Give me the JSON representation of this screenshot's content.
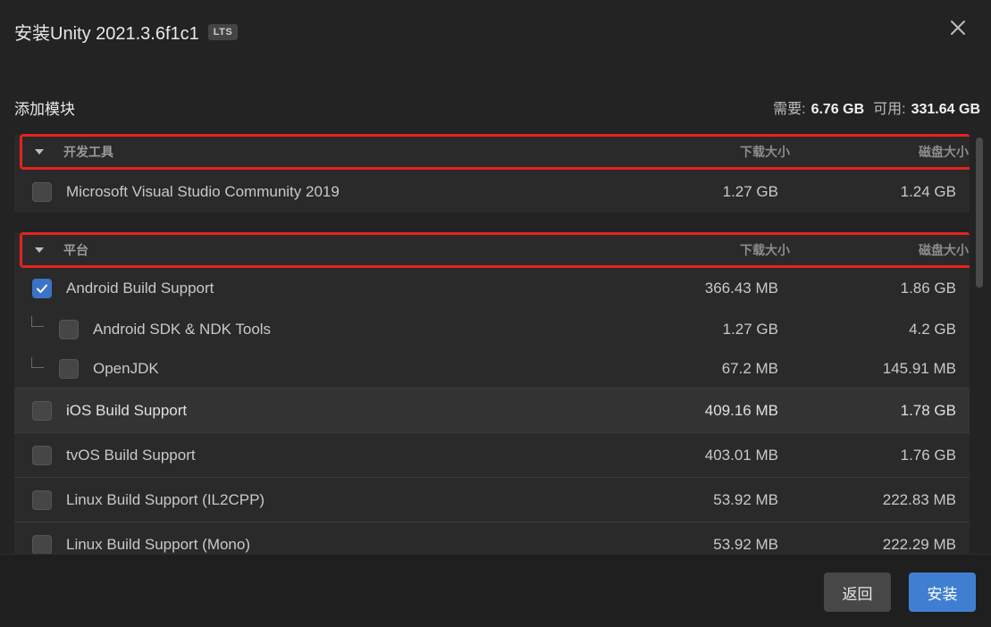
{
  "window": {
    "title": "安装Unity 2021.3.6f1c1",
    "badge": "LTS"
  },
  "header": {
    "section_title": "添加模块",
    "required_label": "需要:",
    "required_value": "6.76 GB",
    "available_label": "可用:",
    "available_value": "331.64 GB"
  },
  "groups": [
    {
      "name": "开发工具",
      "col_download": "下载大小",
      "col_disk": "磁盘大小",
      "items": [
        {
          "label": "Microsoft Visual Studio Community 2019",
          "download": "1.27 GB",
          "disk": "1.24 GB",
          "checked": false
        }
      ]
    },
    {
      "name": "平台",
      "col_download": "下载大小",
      "col_disk": "磁盘大小",
      "items": [
        {
          "label": "Android Build Support",
          "download": "366.43 MB",
          "disk": "1.86 GB",
          "checked": true
        },
        {
          "label": "Android SDK & NDK Tools",
          "download": "1.27 GB",
          "disk": "4.2 GB",
          "checked": false
        },
        {
          "label": "OpenJDK",
          "download": "67.2 MB",
          "disk": "145.91 MB",
          "checked": false
        },
        {
          "label": "iOS Build Support",
          "download": "409.16 MB",
          "disk": "1.78 GB",
          "checked": false
        },
        {
          "label": "tvOS Build Support",
          "download": "403.01 MB",
          "disk": "1.76 GB",
          "checked": false
        },
        {
          "label": "Linux Build Support (IL2CPP)",
          "download": "53.92 MB",
          "disk": "222.83 MB",
          "checked": false
        },
        {
          "label": "Linux Build Support (Mono)",
          "download": "53.92 MB",
          "disk": "222.29 MB",
          "checked": false
        }
      ]
    }
  ],
  "footer": {
    "back_label": "返回",
    "install_label": "安装"
  },
  "colors": {
    "accent": "#3f7fd1",
    "highlight_border": "#e3231d",
    "background": "#232323"
  }
}
